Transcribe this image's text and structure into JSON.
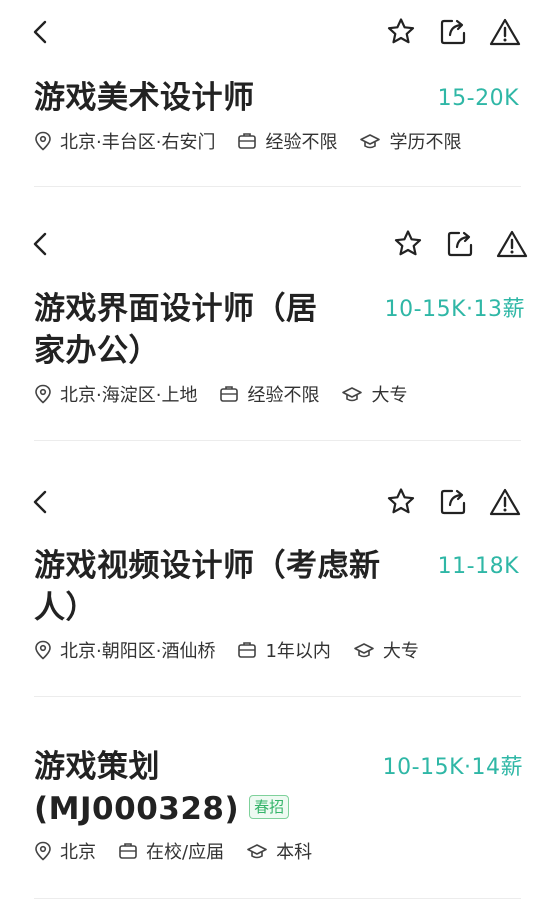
{
  "jobs": [
    {
      "title_line1": "游戏美术设计师",
      "title_line2": "",
      "salary": "15-20K",
      "location": "北京·丰台区·右安门",
      "experience": "经验不限",
      "education": "学历不限",
      "tag": "",
      "has_topbar": true
    },
    {
      "title_line1": "游戏界面设计师（居",
      "title_line2": "家办公）",
      "salary": "10-15K·13薪",
      "location": "北京·海淀区·上地",
      "experience": "经验不限",
      "education": "大专",
      "tag": "",
      "has_topbar": true
    },
    {
      "title_line1": "游戏视频设计师（考虑新",
      "title_line2": "人）",
      "salary": "11-18K",
      "location": "北京·朝阳区·酒仙桥",
      "experience": "1年以内",
      "education": "大专",
      "tag": "",
      "has_topbar": true
    },
    {
      "title_line1": "游戏策划",
      "title_line2": "(MJ000328)",
      "salary": "10-15K·14薪",
      "location": "北京",
      "experience": "在校/应届",
      "education": "本科",
      "tag": "春招",
      "has_topbar": false
    }
  ],
  "icons": {
    "back": "back-arrow-icon",
    "favorite": "star-icon",
    "share": "share-icon",
    "report": "warning-icon",
    "location": "location-pin-icon",
    "experience": "briefcase-icon",
    "education": "graduation-cap-icon"
  },
  "colors": {
    "salary": "#2fb7a6",
    "tag_text": "#35b46a",
    "tag_border": "#7fd19b",
    "text": "#222222",
    "divider": "#ececec"
  }
}
